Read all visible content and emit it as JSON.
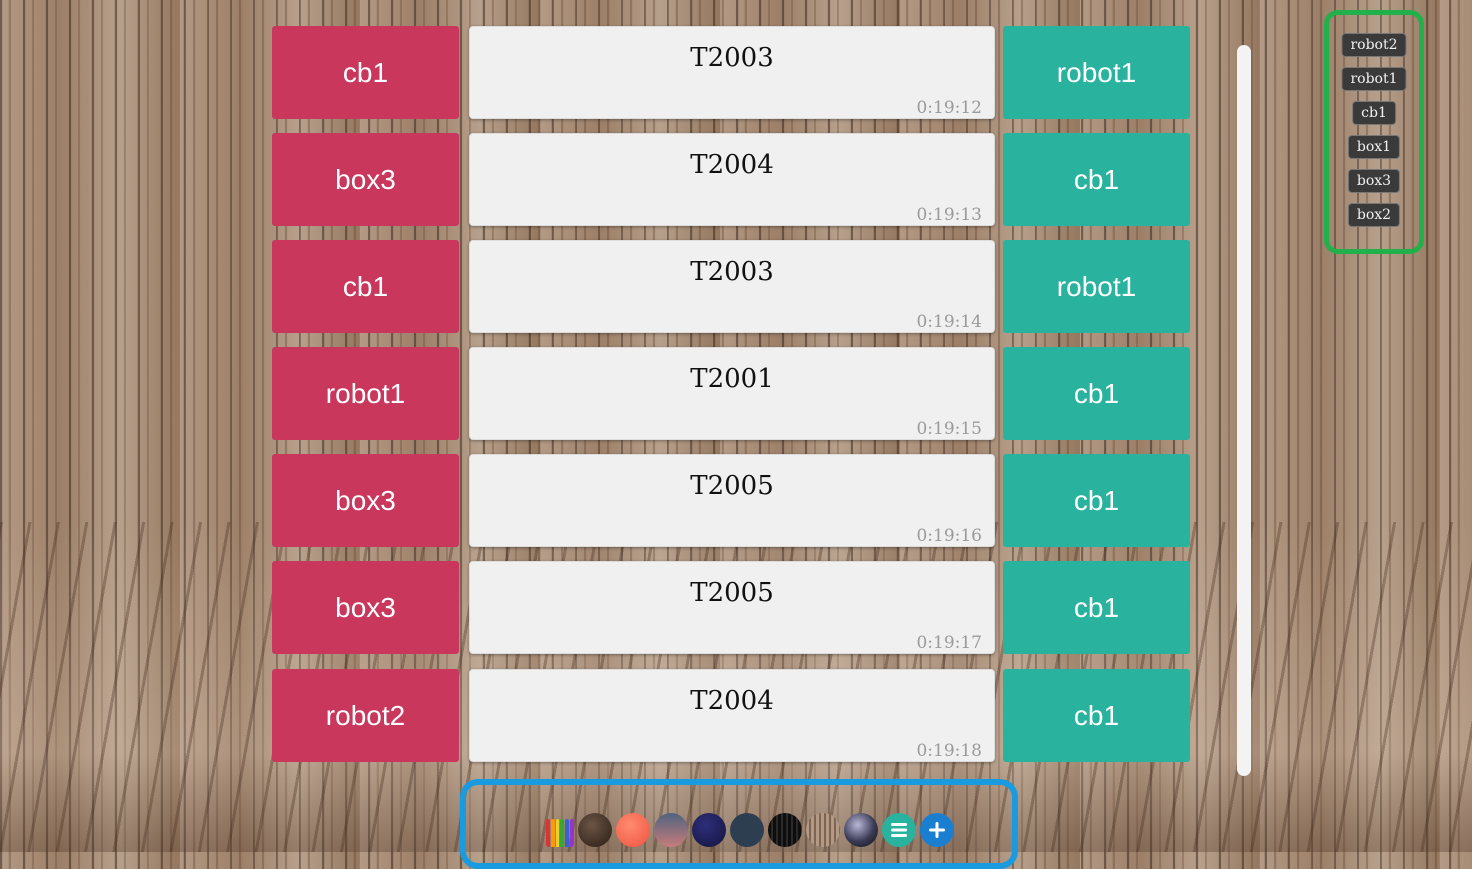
{
  "rows": [
    {
      "left": "cb1",
      "id": "T2003",
      "time": "0:19:12",
      "right": "robot1"
    },
    {
      "left": "box3",
      "id": "T2004",
      "time": "0:19:13",
      "right": "cb1"
    },
    {
      "left": "cb1",
      "id": "T2003",
      "time": "0:19:14",
      "right": "robot1"
    },
    {
      "left": "robot1",
      "id": "T2001",
      "time": "0:19:15",
      "right": "cb1"
    },
    {
      "left": "box3",
      "id": "T2005",
      "time": "0:19:16",
      "right": "cb1"
    },
    {
      "left": "box3",
      "id": "T2005",
      "time": "0:19:17",
      "right": "cb1"
    },
    {
      "left": "robot2",
      "id": "T2004",
      "time": "0:19:18",
      "right": "cb1"
    }
  ],
  "legend": {
    "items": [
      "robot2",
      "robot1",
      "cb1",
      "box1",
      "box3",
      "box2"
    ]
  },
  "toolbar": {
    "tools": [
      {
        "name": "pencils-icon"
      },
      {
        "name": "theme-dark-brown",
        "color": "#3b2a20"
      },
      {
        "name": "theme-coral",
        "color": "#fb6e5a"
      },
      {
        "name": "theme-slate-rose",
        "color": "#5e6b7f"
      },
      {
        "name": "theme-navy",
        "color": "#1f1f5c"
      },
      {
        "name": "theme-dark-slate",
        "color": "#2c3e50"
      },
      {
        "name": "theme-black-wood",
        "color": "#151515"
      },
      {
        "name": "theme-wood",
        "color": "#a68b74"
      },
      {
        "name": "theme-galaxy",
        "color": "#3a3a55"
      },
      {
        "name": "menu-icon",
        "color": "#29b39f"
      },
      {
        "name": "add-icon",
        "color": "#1a7fd0"
      }
    ]
  },
  "colors": {
    "left_cells": "#c9375d",
    "right_cells": "#29b39f",
    "legend_border": "#22b04b",
    "toolbar_border": "#1a9be0"
  }
}
